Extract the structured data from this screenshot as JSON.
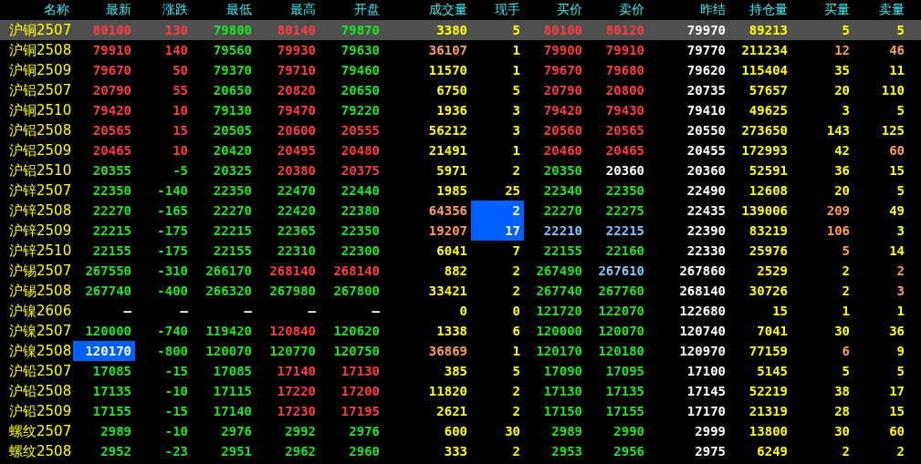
{
  "columns": [
    "名称",
    "最新",
    "涨跌",
    "最低",
    "最高",
    "开盘",
    "成交量",
    "现手",
    "买价",
    "卖价",
    "昨结",
    "持仓量",
    "买量",
    "卖量"
  ],
  "rows": [
    {
      "name": "沪铜2507",
      "selected": true,
      "cells": [
        {
          "text": "80100",
          "color": "#ff3c3c",
          "highlighted": false
        },
        {
          "text": "130",
          "color": "#ff3c3c",
          "highlighted": false
        },
        {
          "text": "79800",
          "color": "#1ee61e",
          "highlighted": false
        },
        {
          "text": "80140",
          "color": "#ff3c3c",
          "highlighted": false
        },
        {
          "text": "79870",
          "color": "#1ee61e",
          "highlighted": false
        },
        {
          "text": "3380",
          "color": "#ffff00",
          "highlighted": false
        },
        {
          "text": "5",
          "color": "#ffff00",
          "highlighted": false
        },
        {
          "text": "80100",
          "color": "#ff3c3c",
          "highlighted": false
        },
        {
          "text": "80120",
          "color": "#ff3c3c",
          "highlighted": false
        },
        {
          "text": "79970",
          "color": "#ffffff",
          "highlighted": false
        },
        {
          "text": "89213",
          "color": "#ffff00",
          "highlighted": false
        },
        {
          "text": "5",
          "color": "#ffff00",
          "highlighted": false
        },
        {
          "text": "5",
          "color": "#ffff00",
          "highlighted": false
        }
      ]
    },
    {
      "name": "沪铜2508",
      "selected": false,
      "cells": [
        {
          "text": "79910",
          "color": "#ff3c3c",
          "highlighted": false
        },
        {
          "text": "140",
          "color": "#ff3c3c",
          "highlighted": false
        },
        {
          "text": "79560",
          "color": "#1ee61e",
          "highlighted": false
        },
        {
          "text": "79930",
          "color": "#ff3c3c",
          "highlighted": false
        },
        {
          "text": "79630",
          "color": "#1ee61e",
          "highlighted": false
        },
        {
          "text": "36107",
          "color": "#ff9c50",
          "highlighted": false
        },
        {
          "text": "1",
          "color": "#ffff00",
          "highlighted": false
        },
        {
          "text": "79900",
          "color": "#ff3c3c",
          "highlighted": false
        },
        {
          "text": "79910",
          "color": "#ff3c3c",
          "highlighted": false
        },
        {
          "text": "79770",
          "color": "#ffffff",
          "highlighted": false
        },
        {
          "text": "211234",
          "color": "#ffff00",
          "highlighted": false
        },
        {
          "text": "12",
          "color": "#ff9c50",
          "highlighted": false
        },
        {
          "text": "46",
          "color": "#ff9c50",
          "highlighted": false
        }
      ]
    },
    {
      "name": "沪铜2509",
      "selected": false,
      "cells": [
        {
          "text": "79670",
          "color": "#ff3c3c",
          "highlighted": false
        },
        {
          "text": "50",
          "color": "#ff3c3c",
          "highlighted": false
        },
        {
          "text": "79370",
          "color": "#1ee61e",
          "highlighted": false
        },
        {
          "text": "79710",
          "color": "#ff3c3c",
          "highlighted": false
        },
        {
          "text": "79460",
          "color": "#1ee61e",
          "highlighted": false
        },
        {
          "text": "11570",
          "color": "#ffff00",
          "highlighted": false
        },
        {
          "text": "1",
          "color": "#ffff00",
          "highlighted": false
        },
        {
          "text": "79670",
          "color": "#ff3c3c",
          "highlighted": false
        },
        {
          "text": "79680",
          "color": "#ff3c3c",
          "highlighted": false
        },
        {
          "text": "79620",
          "color": "#ffffff",
          "highlighted": false
        },
        {
          "text": "115404",
          "color": "#ffff00",
          "highlighted": false
        },
        {
          "text": "35",
          "color": "#ffff00",
          "highlighted": false
        },
        {
          "text": "11",
          "color": "#ffff00",
          "highlighted": false
        }
      ]
    },
    {
      "name": "沪铝2507",
      "selected": false,
      "cells": [
        {
          "text": "20790",
          "color": "#ff3c3c",
          "highlighted": false
        },
        {
          "text": "55",
          "color": "#ff3c3c",
          "highlighted": false
        },
        {
          "text": "20650",
          "color": "#1ee61e",
          "highlighted": false
        },
        {
          "text": "20820",
          "color": "#ff3c3c",
          "highlighted": false
        },
        {
          "text": "20650",
          "color": "#1ee61e",
          "highlighted": false
        },
        {
          "text": "6750",
          "color": "#ffff00",
          "highlighted": false
        },
        {
          "text": "5",
          "color": "#ffff00",
          "highlighted": false
        },
        {
          "text": "20790",
          "color": "#ff3c3c",
          "highlighted": false
        },
        {
          "text": "20800",
          "color": "#ff3c3c",
          "highlighted": false
        },
        {
          "text": "20735",
          "color": "#ffffff",
          "highlighted": false
        },
        {
          "text": "57657",
          "color": "#ffff00",
          "highlighted": false
        },
        {
          "text": "20",
          "color": "#ffff00",
          "highlighted": false
        },
        {
          "text": "110",
          "color": "#ffff00",
          "highlighted": false
        }
      ]
    },
    {
      "name": "沪铜2510",
      "selected": false,
      "cells": [
        {
          "text": "79420",
          "color": "#ff3c3c",
          "highlighted": false
        },
        {
          "text": "10",
          "color": "#ff3c3c",
          "highlighted": false
        },
        {
          "text": "79130",
          "color": "#1ee61e",
          "highlighted": false
        },
        {
          "text": "79470",
          "color": "#ff3c3c",
          "highlighted": false
        },
        {
          "text": "79220",
          "color": "#1ee61e",
          "highlighted": false
        },
        {
          "text": "1936",
          "color": "#ffff00",
          "highlighted": false
        },
        {
          "text": "3",
          "color": "#ffff00",
          "highlighted": false
        },
        {
          "text": "79420",
          "color": "#ff3c3c",
          "highlighted": false
        },
        {
          "text": "79430",
          "color": "#ff3c3c",
          "highlighted": false
        },
        {
          "text": "79410",
          "color": "#ffffff",
          "highlighted": false
        },
        {
          "text": "49625",
          "color": "#ffff00",
          "highlighted": false
        },
        {
          "text": "3",
          "color": "#ffff00",
          "highlighted": false
        },
        {
          "text": "5",
          "color": "#ffff00",
          "highlighted": false
        }
      ]
    },
    {
      "name": "沪铝2508",
      "selected": false,
      "cells": [
        {
          "text": "20565",
          "color": "#ff3c3c",
          "highlighted": false
        },
        {
          "text": "15",
          "color": "#ff3c3c",
          "highlighted": false
        },
        {
          "text": "20505",
          "color": "#1ee61e",
          "highlighted": false
        },
        {
          "text": "20600",
          "color": "#ff3c3c",
          "highlighted": false
        },
        {
          "text": "20555",
          "color": "#ff3c3c",
          "highlighted": false
        },
        {
          "text": "56212",
          "color": "#ffff00",
          "highlighted": false
        },
        {
          "text": "3",
          "color": "#ffff00",
          "highlighted": false
        },
        {
          "text": "20560",
          "color": "#ff3c3c",
          "highlighted": false
        },
        {
          "text": "20565",
          "color": "#ff3c3c",
          "highlighted": false
        },
        {
          "text": "20550",
          "color": "#ffffff",
          "highlighted": false
        },
        {
          "text": "273650",
          "color": "#ffff00",
          "highlighted": false
        },
        {
          "text": "143",
          "color": "#ffff00",
          "highlighted": false
        },
        {
          "text": "125",
          "color": "#ffff00",
          "highlighted": false
        }
      ]
    },
    {
      "name": "沪铝2509",
      "selected": false,
      "cells": [
        {
          "text": "20465",
          "color": "#ff3c3c",
          "highlighted": false
        },
        {
          "text": "10",
          "color": "#ff3c3c",
          "highlighted": false
        },
        {
          "text": "20420",
          "color": "#1ee61e",
          "highlighted": false
        },
        {
          "text": "20495",
          "color": "#ff3c3c",
          "highlighted": false
        },
        {
          "text": "20480",
          "color": "#ff3c3c",
          "highlighted": false
        },
        {
          "text": "21491",
          "color": "#ffff00",
          "highlighted": false
        },
        {
          "text": "1",
          "color": "#ffff00",
          "highlighted": false
        },
        {
          "text": "20460",
          "color": "#ff3c3c",
          "highlighted": false
        },
        {
          "text": "20465",
          "color": "#ff3c3c",
          "highlighted": false
        },
        {
          "text": "20455",
          "color": "#ffffff",
          "highlighted": false
        },
        {
          "text": "172993",
          "color": "#ffff00",
          "highlighted": false
        },
        {
          "text": "42",
          "color": "#ffff00",
          "highlighted": false
        },
        {
          "text": "60",
          "color": "#ff9c50",
          "highlighted": false
        }
      ]
    },
    {
      "name": "沪铝2510",
      "selected": false,
      "cells": [
        {
          "text": "20355",
          "color": "#1ee61e",
          "highlighted": false
        },
        {
          "text": "-5",
          "color": "#1ee61e",
          "highlighted": false
        },
        {
          "text": "20325",
          "color": "#1ee61e",
          "highlighted": false
        },
        {
          "text": "20380",
          "color": "#ff3c3c",
          "highlighted": false
        },
        {
          "text": "20375",
          "color": "#ff3c3c",
          "highlighted": false
        },
        {
          "text": "5971",
          "color": "#ffff00",
          "highlighted": false
        },
        {
          "text": "2",
          "color": "#ffff00",
          "highlighted": false
        },
        {
          "text": "20350",
          "color": "#1ee61e",
          "highlighted": false
        },
        {
          "text": "20360",
          "color": "#ffffff",
          "highlighted": false
        },
        {
          "text": "20360",
          "color": "#ffffff",
          "highlighted": false
        },
        {
          "text": "52591",
          "color": "#ffff00",
          "highlighted": false
        },
        {
          "text": "36",
          "color": "#ffff00",
          "highlighted": false
        },
        {
          "text": "15",
          "color": "#ffff00",
          "highlighted": false
        }
      ]
    },
    {
      "name": "沪锌2507",
      "selected": false,
      "cells": [
        {
          "text": "22350",
          "color": "#1ee61e",
          "highlighted": false
        },
        {
          "text": "-140",
          "color": "#1ee61e",
          "highlighted": false
        },
        {
          "text": "22350",
          "color": "#1ee61e",
          "highlighted": false
        },
        {
          "text": "22470",
          "color": "#1ee61e",
          "highlighted": false
        },
        {
          "text": "22440",
          "color": "#1ee61e",
          "highlighted": false
        },
        {
          "text": "1985",
          "color": "#ffff00",
          "highlighted": false
        },
        {
          "text": "25",
          "color": "#ffff00",
          "highlighted": false
        },
        {
          "text": "22340",
          "color": "#1ee61e",
          "highlighted": false
        },
        {
          "text": "22350",
          "color": "#1ee61e",
          "highlighted": false
        },
        {
          "text": "22490",
          "color": "#ffffff",
          "highlighted": false
        },
        {
          "text": "12608",
          "color": "#ffff00",
          "highlighted": false
        },
        {
          "text": "20",
          "color": "#ffff00",
          "highlighted": false
        },
        {
          "text": "5",
          "color": "#ffff00",
          "highlighted": false
        }
      ]
    },
    {
      "name": "沪锌2508",
      "selected": false,
      "cells": [
        {
          "text": "22270",
          "color": "#1ee61e",
          "highlighted": false
        },
        {
          "text": "-165",
          "color": "#1ee61e",
          "highlighted": false
        },
        {
          "text": "22270",
          "color": "#1ee61e",
          "highlighted": false
        },
        {
          "text": "22420",
          "color": "#1ee61e",
          "highlighted": false
        },
        {
          "text": "22380",
          "color": "#1ee61e",
          "highlighted": false
        },
        {
          "text": "64356",
          "color": "#ff9c50",
          "highlighted": false
        },
        {
          "text": "2",
          "color": "#ffffff",
          "highlighted": true
        },
        {
          "text": "22270",
          "color": "#1ee61e",
          "highlighted": false
        },
        {
          "text": "22275",
          "color": "#1ee61e",
          "highlighted": false
        },
        {
          "text": "22435",
          "color": "#ffffff",
          "highlighted": false
        },
        {
          "text": "139006",
          "color": "#ffff00",
          "highlighted": false
        },
        {
          "text": "209",
          "color": "#ff9c50",
          "highlighted": false
        },
        {
          "text": "49",
          "color": "#ffff00",
          "highlighted": false
        }
      ]
    },
    {
      "name": "沪锌2509",
      "selected": false,
      "cells": [
        {
          "text": "22215",
          "color": "#1ee61e",
          "highlighted": false
        },
        {
          "text": "-175",
          "color": "#1ee61e",
          "highlighted": false
        },
        {
          "text": "22215",
          "color": "#1ee61e",
          "highlighted": false
        },
        {
          "text": "22365",
          "color": "#1ee61e",
          "highlighted": false
        },
        {
          "text": "22350",
          "color": "#1ee61e",
          "highlighted": false
        },
        {
          "text": "19207",
          "color": "#ff9c50",
          "highlighted": false
        },
        {
          "text": "17",
          "color": "#ffffff",
          "highlighted": true
        },
        {
          "text": "22210",
          "color": "#80c8ff",
          "highlighted": false
        },
        {
          "text": "22215",
          "color": "#80c8ff",
          "highlighted": false
        },
        {
          "text": "22390",
          "color": "#ffffff",
          "highlighted": false
        },
        {
          "text": "83219",
          "color": "#ffff00",
          "highlighted": false
        },
        {
          "text": "106",
          "color": "#ff9c50",
          "highlighted": false
        },
        {
          "text": "3",
          "color": "#ffff00",
          "highlighted": false
        }
      ]
    },
    {
      "name": "沪锌2510",
      "selected": false,
      "cells": [
        {
          "text": "22155",
          "color": "#1ee61e",
          "highlighted": false
        },
        {
          "text": "-175",
          "color": "#1ee61e",
          "highlighted": false
        },
        {
          "text": "22155",
          "color": "#1ee61e",
          "highlighted": false
        },
        {
          "text": "22310",
          "color": "#1ee61e",
          "highlighted": false
        },
        {
          "text": "22300",
          "color": "#1ee61e",
          "highlighted": false
        },
        {
          "text": "6041",
          "color": "#ffff00",
          "highlighted": false
        },
        {
          "text": "7",
          "color": "#ffff00",
          "highlighted": false
        },
        {
          "text": "22155",
          "color": "#1ee61e",
          "highlighted": false
        },
        {
          "text": "22160",
          "color": "#1ee61e",
          "highlighted": false
        },
        {
          "text": "22330",
          "color": "#ffffff",
          "highlighted": false
        },
        {
          "text": "25976",
          "color": "#ffff00",
          "highlighted": false
        },
        {
          "text": "5",
          "color": "#ff9c50",
          "highlighted": false
        },
        {
          "text": "14",
          "color": "#ffff00",
          "highlighted": false
        }
      ]
    },
    {
      "name": "沪锡2507",
      "selected": false,
      "cells": [
        {
          "text": "267550",
          "color": "#1ee61e",
          "highlighted": false
        },
        {
          "text": "-310",
          "color": "#1ee61e",
          "highlighted": false
        },
        {
          "text": "266170",
          "color": "#1ee61e",
          "highlighted": false
        },
        {
          "text": "268140",
          "color": "#ff3c3c",
          "highlighted": false
        },
        {
          "text": "268140",
          "color": "#ff3c3c",
          "highlighted": false
        },
        {
          "text": "882",
          "color": "#ffff00",
          "highlighted": false
        },
        {
          "text": "2",
          "color": "#ffff00",
          "highlighted": false
        },
        {
          "text": "267490",
          "color": "#1ee61e",
          "highlighted": false
        },
        {
          "text": "267610",
          "color": "#80c8ff",
          "highlighted": false
        },
        {
          "text": "267860",
          "color": "#ffffff",
          "highlighted": false
        },
        {
          "text": "2529",
          "color": "#ffff00",
          "highlighted": false
        },
        {
          "text": "2",
          "color": "#ffff00",
          "highlighted": false
        },
        {
          "text": "2",
          "color": "#ff9c50",
          "highlighted": false
        }
      ]
    },
    {
      "name": "沪锡2508",
      "selected": false,
      "cells": [
        {
          "text": "267740",
          "color": "#1ee61e",
          "highlighted": false
        },
        {
          "text": "-400",
          "color": "#1ee61e",
          "highlighted": false
        },
        {
          "text": "266320",
          "color": "#1ee61e",
          "highlighted": false
        },
        {
          "text": "267980",
          "color": "#1ee61e",
          "highlighted": false
        },
        {
          "text": "267800",
          "color": "#1ee61e",
          "highlighted": false
        },
        {
          "text": "33421",
          "color": "#ffff00",
          "highlighted": false
        },
        {
          "text": "2",
          "color": "#ffff00",
          "highlighted": false
        },
        {
          "text": "267740",
          "color": "#1ee61e",
          "highlighted": false
        },
        {
          "text": "267760",
          "color": "#1ee61e",
          "highlighted": false
        },
        {
          "text": "268140",
          "color": "#ffffff",
          "highlighted": false
        },
        {
          "text": "30726",
          "color": "#ffff00",
          "highlighted": false
        },
        {
          "text": "2",
          "color": "#ffff00",
          "highlighted": false
        },
        {
          "text": "3",
          "color": "#ff9c50",
          "highlighted": false
        }
      ]
    },
    {
      "name": "沪镍2606",
      "selected": false,
      "cells": [
        {
          "text": "—",
          "color": "#ffffff",
          "highlighted": false
        },
        {
          "text": "—",
          "color": "#ffffff",
          "highlighted": false
        },
        {
          "text": "—",
          "color": "#ffffff",
          "highlighted": false
        },
        {
          "text": "—",
          "color": "#ffffff",
          "highlighted": false
        },
        {
          "text": "—",
          "color": "#ffffff",
          "highlighted": false
        },
        {
          "text": "0",
          "color": "#ffff00",
          "highlighted": false
        },
        {
          "text": "0",
          "color": "#ffff00",
          "highlighted": false
        },
        {
          "text": "121720",
          "color": "#1ee61e",
          "highlighted": false
        },
        {
          "text": "122070",
          "color": "#1ee61e",
          "highlighted": false
        },
        {
          "text": "122680",
          "color": "#ffffff",
          "highlighted": false
        },
        {
          "text": "15",
          "color": "#ffff00",
          "highlighted": false
        },
        {
          "text": "1",
          "color": "#ffff00",
          "highlighted": false
        },
        {
          "text": "1",
          "color": "#ffff00",
          "highlighted": false
        }
      ]
    },
    {
      "name": "沪镍2507",
      "selected": false,
      "cells": [
        {
          "text": "120000",
          "color": "#1ee61e",
          "highlighted": false
        },
        {
          "text": "-740",
          "color": "#1ee61e",
          "highlighted": false
        },
        {
          "text": "119420",
          "color": "#1ee61e",
          "highlighted": false
        },
        {
          "text": "120840",
          "color": "#ff3c3c",
          "highlighted": false
        },
        {
          "text": "120620",
          "color": "#1ee61e",
          "highlighted": false
        },
        {
          "text": "1338",
          "color": "#ffff00",
          "highlighted": false
        },
        {
          "text": "6",
          "color": "#ffff00",
          "highlighted": false
        },
        {
          "text": "120000",
          "color": "#1ee61e",
          "highlighted": false
        },
        {
          "text": "120070",
          "color": "#1ee61e",
          "highlighted": false
        },
        {
          "text": "120740",
          "color": "#ffffff",
          "highlighted": false
        },
        {
          "text": "7041",
          "color": "#ffff00",
          "highlighted": false
        },
        {
          "text": "30",
          "color": "#ffff00",
          "highlighted": false
        },
        {
          "text": "36",
          "color": "#ffff00",
          "highlighted": false
        }
      ]
    },
    {
      "name": "沪镍2508",
      "selected": false,
      "cells": [
        {
          "text": "120170",
          "color": "#ffffff",
          "highlighted": true
        },
        {
          "text": "-800",
          "color": "#1ee61e",
          "highlighted": false
        },
        {
          "text": "120070",
          "color": "#1ee61e",
          "highlighted": false
        },
        {
          "text": "120770",
          "color": "#1ee61e",
          "highlighted": false
        },
        {
          "text": "120750",
          "color": "#1ee61e",
          "highlighted": false
        },
        {
          "text": "36869",
          "color": "#ff9c50",
          "highlighted": false
        },
        {
          "text": "1",
          "color": "#ffff00",
          "highlighted": false
        },
        {
          "text": "120170",
          "color": "#1ee61e",
          "highlighted": false
        },
        {
          "text": "120180",
          "color": "#1ee61e",
          "highlighted": false
        },
        {
          "text": "120970",
          "color": "#ffffff",
          "highlighted": false
        },
        {
          "text": "77159",
          "color": "#ffff00",
          "highlighted": false
        },
        {
          "text": "6",
          "color": "#ff9c50",
          "highlighted": false
        },
        {
          "text": "9",
          "color": "#ffff00",
          "highlighted": false
        }
      ]
    },
    {
      "name": "沪铅2507",
      "selected": false,
      "cells": [
        {
          "text": "17085",
          "color": "#1ee61e",
          "highlighted": false
        },
        {
          "text": "-15",
          "color": "#1ee61e",
          "highlighted": false
        },
        {
          "text": "17085",
          "color": "#1ee61e",
          "highlighted": false
        },
        {
          "text": "17140",
          "color": "#ff3c3c",
          "highlighted": false
        },
        {
          "text": "17130",
          "color": "#ff3c3c",
          "highlighted": false
        },
        {
          "text": "385",
          "color": "#ffff00",
          "highlighted": false
        },
        {
          "text": "5",
          "color": "#ffff00",
          "highlighted": false
        },
        {
          "text": "17090",
          "color": "#1ee61e",
          "highlighted": false
        },
        {
          "text": "17095",
          "color": "#1ee61e",
          "highlighted": false
        },
        {
          "text": "17100",
          "color": "#ffffff",
          "highlighted": false
        },
        {
          "text": "5145",
          "color": "#ffff00",
          "highlighted": false
        },
        {
          "text": "5",
          "color": "#ffff00",
          "highlighted": false
        },
        {
          "text": "5",
          "color": "#ffff00",
          "highlighted": false
        }
      ]
    },
    {
      "name": "沪铅2508",
      "selected": false,
      "cells": [
        {
          "text": "17135",
          "color": "#1ee61e",
          "highlighted": false
        },
        {
          "text": "-10",
          "color": "#1ee61e",
          "highlighted": false
        },
        {
          "text": "17115",
          "color": "#1ee61e",
          "highlighted": false
        },
        {
          "text": "17220",
          "color": "#ff3c3c",
          "highlighted": false
        },
        {
          "text": "17200",
          "color": "#ff3c3c",
          "highlighted": false
        },
        {
          "text": "11820",
          "color": "#ffff00",
          "highlighted": false
        },
        {
          "text": "2",
          "color": "#ffff00",
          "highlighted": false
        },
        {
          "text": "17130",
          "color": "#1ee61e",
          "highlighted": false
        },
        {
          "text": "17135",
          "color": "#1ee61e",
          "highlighted": false
        },
        {
          "text": "17145",
          "color": "#ffffff",
          "highlighted": false
        },
        {
          "text": "52219",
          "color": "#ffff00",
          "highlighted": false
        },
        {
          "text": "38",
          "color": "#ffff00",
          "highlighted": false
        },
        {
          "text": "17",
          "color": "#ffff00",
          "highlighted": false
        }
      ]
    },
    {
      "name": "沪铅2509",
      "selected": false,
      "cells": [
        {
          "text": "17155",
          "color": "#1ee61e",
          "highlighted": false
        },
        {
          "text": "-15",
          "color": "#1ee61e",
          "highlighted": false
        },
        {
          "text": "17140",
          "color": "#1ee61e",
          "highlighted": false
        },
        {
          "text": "17230",
          "color": "#ff3c3c",
          "highlighted": false
        },
        {
          "text": "17195",
          "color": "#ff3c3c",
          "highlighted": false
        },
        {
          "text": "2621",
          "color": "#ffff00",
          "highlighted": false
        },
        {
          "text": "2",
          "color": "#ffff00",
          "highlighted": false
        },
        {
          "text": "17150",
          "color": "#1ee61e",
          "highlighted": false
        },
        {
          "text": "17155",
          "color": "#1ee61e",
          "highlighted": false
        },
        {
          "text": "17170",
          "color": "#ffffff",
          "highlighted": false
        },
        {
          "text": "21319",
          "color": "#ffff00",
          "highlighted": false
        },
        {
          "text": "28",
          "color": "#ffff00",
          "highlighted": false
        },
        {
          "text": "15",
          "color": "#ffff00",
          "highlighted": false
        }
      ]
    },
    {
      "name": "螺纹2507",
      "selected": false,
      "cells": [
        {
          "text": "2989",
          "color": "#1ee61e",
          "highlighted": false
        },
        {
          "text": "-10",
          "color": "#1ee61e",
          "highlighted": false
        },
        {
          "text": "2976",
          "color": "#1ee61e",
          "highlighted": false
        },
        {
          "text": "2992",
          "color": "#1ee61e",
          "highlighted": false
        },
        {
          "text": "2976",
          "color": "#1ee61e",
          "highlighted": false
        },
        {
          "text": "600",
          "color": "#ffff00",
          "highlighted": false
        },
        {
          "text": "30",
          "color": "#ffff00",
          "highlighted": false
        },
        {
          "text": "2989",
          "color": "#1ee61e",
          "highlighted": false
        },
        {
          "text": "2990",
          "color": "#1ee61e",
          "highlighted": false
        },
        {
          "text": "2999",
          "color": "#ffffff",
          "highlighted": false
        },
        {
          "text": "13800",
          "color": "#ffff00",
          "highlighted": false
        },
        {
          "text": "30",
          "color": "#ffff00",
          "highlighted": false
        },
        {
          "text": "60",
          "color": "#ffff00",
          "highlighted": false
        }
      ]
    },
    {
      "name": "螺纹2508",
      "selected": false,
      "cells": [
        {
          "text": "2952",
          "color": "#1ee61e",
          "highlighted": false
        },
        {
          "text": "-23",
          "color": "#1ee61e",
          "highlighted": false
        },
        {
          "text": "2951",
          "color": "#1ee61e",
          "highlighted": false
        },
        {
          "text": "2962",
          "color": "#1ee61e",
          "highlighted": false
        },
        {
          "text": "2960",
          "color": "#1ee61e",
          "highlighted": false
        },
        {
          "text": "333",
          "color": "#ffff00",
          "highlighted": false
        },
        {
          "text": "2",
          "color": "#ffff00",
          "highlighted": false
        },
        {
          "text": "2953",
          "color": "#1ee61e",
          "highlighted": false
        },
        {
          "text": "2956",
          "color": "#1ee61e",
          "highlighted": false
        },
        {
          "text": "2975",
          "color": "#ffffff",
          "highlighted": false
        },
        {
          "text": "6249",
          "color": "#ffff00",
          "highlighted": false
        },
        {
          "text": "2",
          "color": "#ffff00",
          "highlighted": false
        },
        {
          "text": "2",
          "color": "#ffff00",
          "highlighted": false
        }
      ]
    }
  ]
}
